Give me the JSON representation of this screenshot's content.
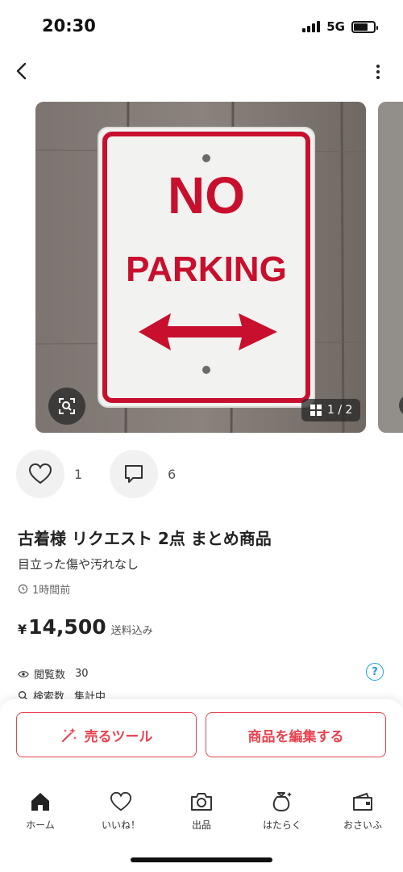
{
  "status_bar": {
    "time": "20:30",
    "network": "5G"
  },
  "photo": {
    "sign_line1": "NO",
    "sign_line2": "PARKING",
    "counter": "1 / 2"
  },
  "reactions": {
    "likes": "1",
    "comments": "6"
  },
  "item": {
    "title": "古着様 リクエスト 2点 まとめ商品",
    "condition": "目立った傷や汚れなし",
    "posted": "1時間前",
    "price_symbol": "¥",
    "price": "14,500",
    "shipping": "送料込み"
  },
  "stats": {
    "views_label": "閲覧数",
    "views_value": "30",
    "search_label": "検索数",
    "search_value": "集計中"
  },
  "actions": {
    "sell_tool": "売るツール",
    "edit_item": "商品を編集する"
  },
  "tabbar": [
    {
      "label": "ホーム",
      "icon": "home-icon"
    },
    {
      "label": "いいね！",
      "icon": "heart-icon"
    },
    {
      "label": "出品",
      "icon": "camera-icon"
    },
    {
      "label": "はたらく",
      "icon": "money-bag-icon"
    },
    {
      "label": "おさいふ",
      "icon": "wallet-icon"
    }
  ],
  "colors": {
    "accent": "#e8424f",
    "link": "#1a9ee0",
    "sign_red": "#c8102e"
  }
}
